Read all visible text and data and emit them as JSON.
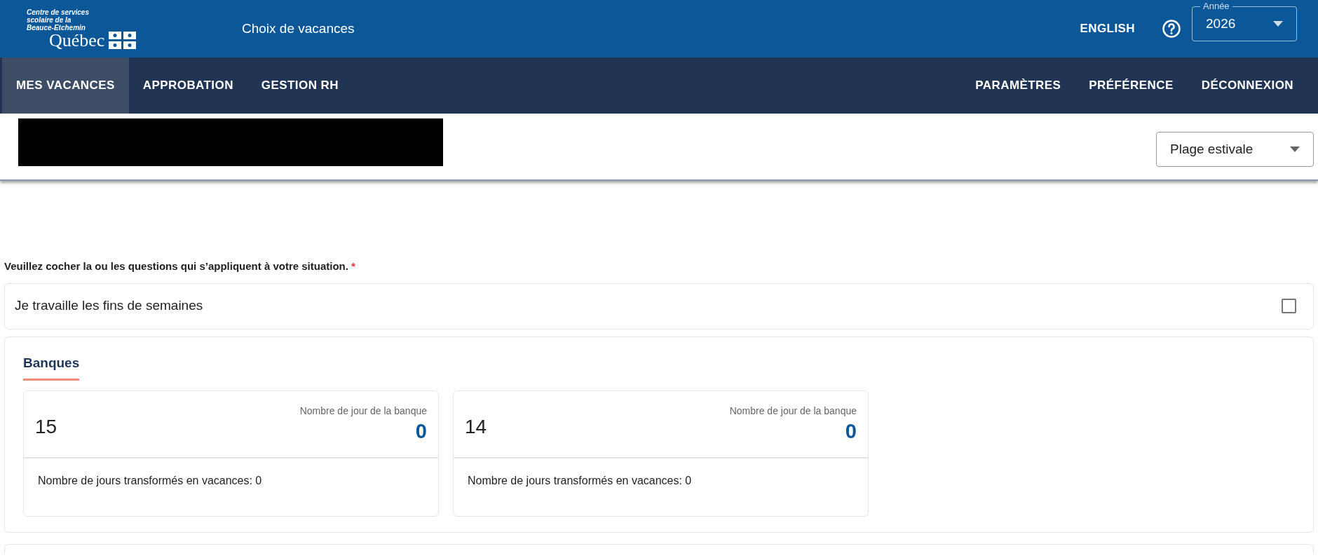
{
  "header": {
    "logo_lines": [
      "Centre de services",
      "scolaire de la",
      "Beauce-Etchemin"
    ],
    "logo_wordmark": "Québec",
    "app_title": "Choix de vacances",
    "language_link": "ENGLISH",
    "year_select": {
      "label": "Année",
      "value": "2026"
    }
  },
  "nav": {
    "left": [
      {
        "label": "MES VACANCES",
        "selected": true
      },
      {
        "label": "APPROBATION",
        "selected": false
      },
      {
        "label": "GESTION RH",
        "selected": false
      }
    ],
    "right": [
      {
        "label": "PARAMÈTRES"
      },
      {
        "label": "PRÉFÉRENCE"
      },
      {
        "label": "DÉCONNEXION"
      }
    ]
  },
  "toolbar": {
    "period_select": {
      "value": "Plage estivale"
    }
  },
  "question": {
    "text": "Veuillez cocher la ou les questions qui s’appliquent à votre situation.",
    "required_mark": "*"
  },
  "options": [
    {
      "label": "Je travaille les fins de semaines",
      "checked": false
    }
  ],
  "banks": {
    "title": "Banques",
    "cards": [
      {
        "number": "15",
        "caption": "Nombre de jour de la banque",
        "value": "0",
        "footer": "Nombre de jours transformés en vacances: 0"
      },
      {
        "number": "14",
        "caption": "Nombre de jour de la banque",
        "value": "0",
        "footer": "Nombre de jours transformés en vacances: 0"
      }
    ]
  }
}
